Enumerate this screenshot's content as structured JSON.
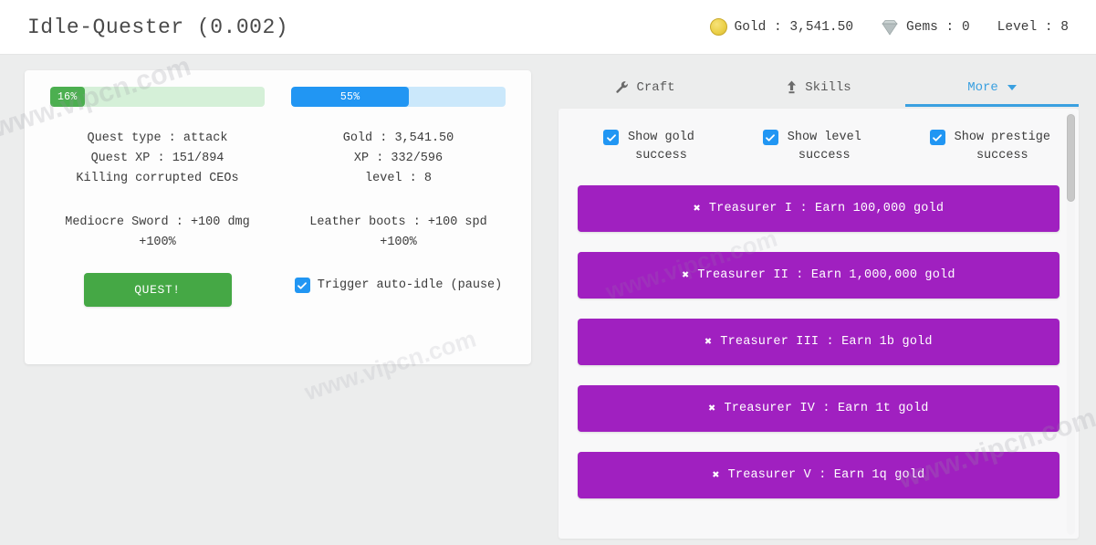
{
  "header": {
    "title": "Idle-Quester (0.002)",
    "stats": [
      {
        "icon": "gold-coin-icon",
        "label": "Gold : 3,541.50"
      },
      {
        "icon": "gem-icon",
        "label": "Gems : 0"
      },
      {
        "icon": "none",
        "label": "Level : 8"
      }
    ]
  },
  "quest_panel": {
    "left": {
      "progress": {
        "percent": 16,
        "label": "16%",
        "color": "#4caf50",
        "track": "#d5f0d8"
      },
      "info": [
        "Quest type : attack",
        "Quest XP : 151/894",
        "Killing corrupted CEOs"
      ],
      "equipment": [
        "Mediocre Sword : +100 dmg",
        "+100%"
      ],
      "quest_button": "QUEST!"
    },
    "right": {
      "progress": {
        "percent": 55,
        "label": "55%",
        "color": "#2196f3",
        "track": "#cbe8fb"
      },
      "info": [
        "Gold : 3,541.50",
        "XP : 332/596",
        "level : 8"
      ],
      "equipment": [
        "Leather boots : +100 spd",
        "+100%"
      ],
      "auto_idle": {
        "label": "Trigger auto-idle (pause)",
        "checked": true
      }
    }
  },
  "tabs": [
    {
      "label": "Craft",
      "icon": "wrench-icon",
      "active": false
    },
    {
      "label": "Skills",
      "icon": "level-up-arrow-icon",
      "active": false
    },
    {
      "label": "More",
      "icon": "chevron-down-icon",
      "active": true
    }
  ],
  "more_panel": {
    "toggles": [
      {
        "line1": "Show gold",
        "line2": "success",
        "checked": true
      },
      {
        "line1": "Show level",
        "line2": "success",
        "checked": true
      },
      {
        "line1": "Show prestige",
        "line2": "success",
        "checked": true
      }
    ],
    "achievements": [
      {
        "icon": "x-mark-icon",
        "label": "Treasurer I : Earn 100,000 gold",
        "unlocked": false
      },
      {
        "icon": "x-mark-icon",
        "label": "Treasurer II : Earn 1,000,000 gold",
        "unlocked": false
      },
      {
        "icon": "x-mark-icon",
        "label": "Treasurer III : Earn 1b gold",
        "unlocked": false
      },
      {
        "icon": "x-mark-icon",
        "label": "Treasurer IV : Earn 1t gold",
        "unlocked": false
      },
      {
        "icon": "x-mark-icon",
        "label": "Treasurer V : Earn 1q gold",
        "unlocked": false
      }
    ],
    "achievement_color": "#a020c0"
  },
  "watermarks": {
    "w1": "www.vipcn.com",
    "w2": "www.vipcn.com",
    "w3": "www.vipcn.com",
    "w4": "www.vipcn.com"
  }
}
